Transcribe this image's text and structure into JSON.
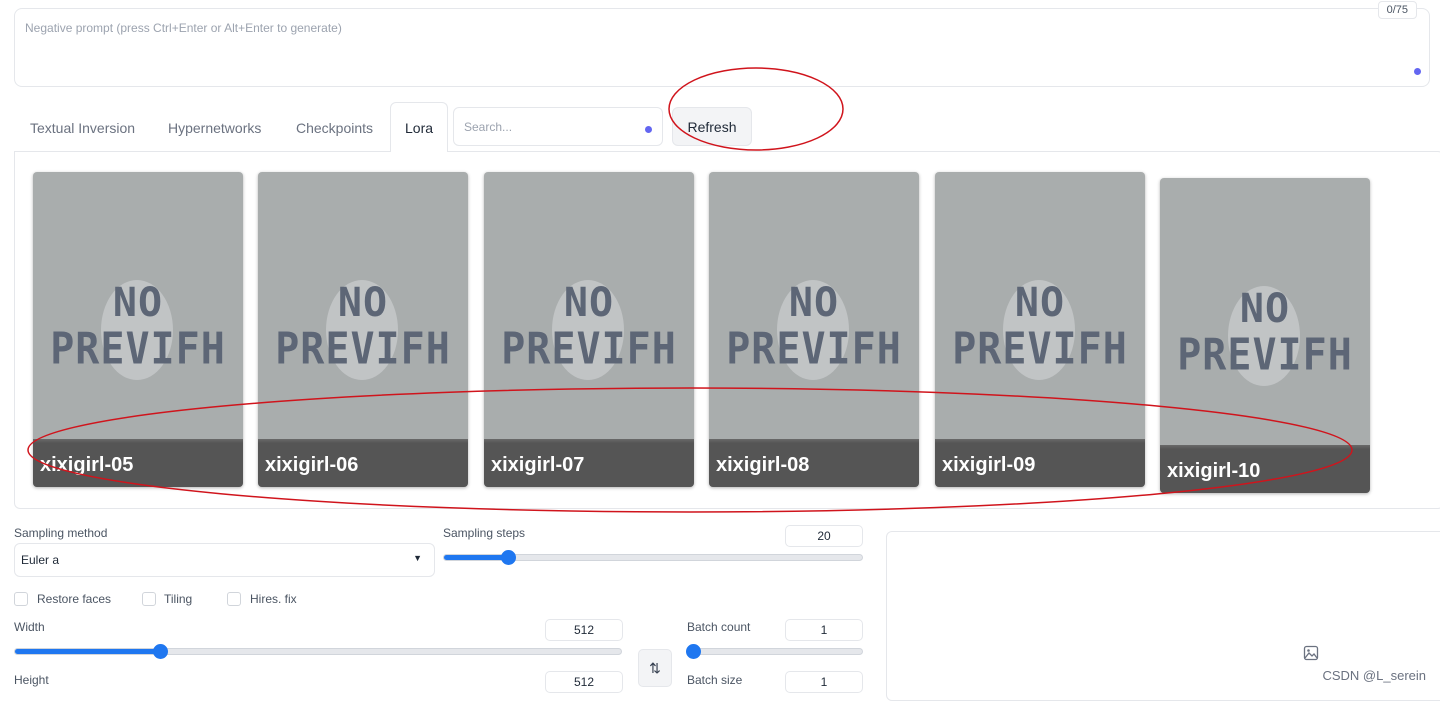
{
  "negative_prompt": {
    "placeholder": "Negative prompt (press Ctrl+Enter or Alt+Enter to generate)",
    "counter": "0/75"
  },
  "tabs": [
    {
      "label": "Textual Inversion"
    },
    {
      "label": "Hypernetworks"
    },
    {
      "label": "Checkpoints"
    },
    {
      "label": "Lora",
      "active": true
    }
  ],
  "search": {
    "placeholder": "Search..."
  },
  "refresh_label": "Refresh",
  "cards": [
    {
      "name": "xixigirl-05",
      "preview": [
        "NO",
        "PREVIFH"
      ]
    },
    {
      "name": "xixigirl-06",
      "preview": [
        "NO",
        "PREVIFH"
      ]
    },
    {
      "name": "xixigirl-07",
      "preview": [
        "NO",
        "PREVIFH"
      ]
    },
    {
      "name": "xixigirl-08",
      "preview": [
        "NO",
        "PREVIFH"
      ]
    },
    {
      "name": "xixigirl-09",
      "preview": [
        "NO",
        "PREVIFH"
      ]
    },
    {
      "name": "xixigirl-10",
      "preview": [
        "NO",
        "PREVIFH"
      ]
    }
  ],
  "sampling_method": {
    "label": "Sampling method",
    "value": "Euler a"
  },
  "sampling_steps": {
    "label": "Sampling steps",
    "value": "20",
    "fraction": 0.14
  },
  "checkboxes": [
    {
      "label": "Restore faces",
      "checked": false
    },
    {
      "label": "Tiling",
      "checked": false
    },
    {
      "label": "Hires. fix",
      "checked": false
    }
  ],
  "width": {
    "label": "Width",
    "value": "512",
    "fraction": 0.23
  },
  "height": {
    "label": "Height",
    "value": "512"
  },
  "batch_count": {
    "label": "Batch count",
    "value": "1",
    "fraction": 0
  },
  "batch_size": {
    "label": "Batch size",
    "value": "1"
  },
  "swap_icon": "swap-vertical-icon",
  "watermark": "CSDN @L_serein",
  "colors": {
    "accent": "#1f77f0",
    "annotation": "#d0141c",
    "dot": "#6366f1"
  }
}
